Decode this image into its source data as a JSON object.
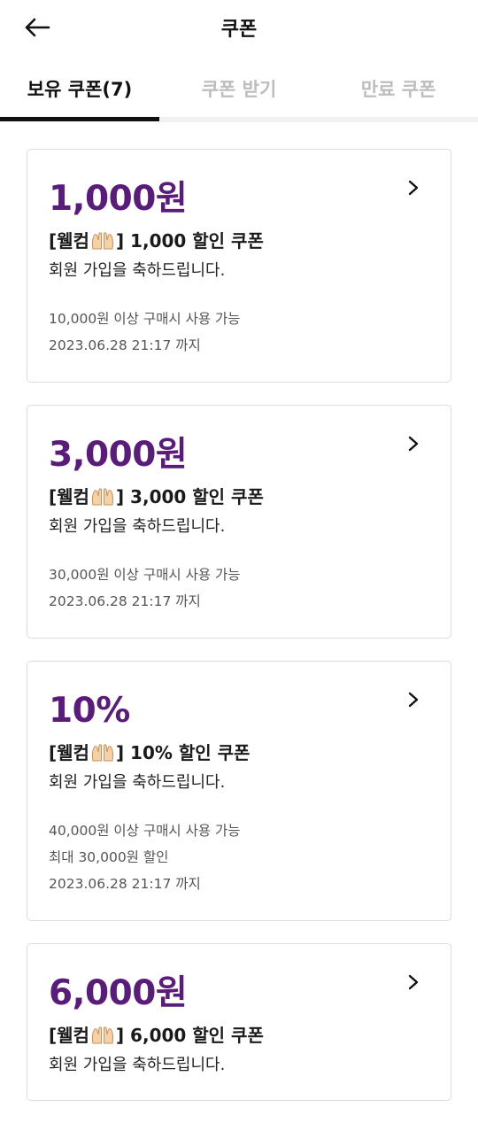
{
  "header": {
    "title": "쿠폰"
  },
  "tabs": [
    {
      "label": "보유 쿠폰(7)",
      "active": true
    },
    {
      "label": "쿠폰 받기",
      "active": false
    },
    {
      "label": "만료 쿠폰",
      "active": false
    }
  ],
  "colors": {
    "accent": "#5a1c7a",
    "active_tab": "#111111",
    "inactive_tab": "#bdbdbd"
  },
  "coupons": [
    {
      "amount": "1,000원",
      "name_prefix": "[웰컴",
      "name_suffix": "] 1,000 할인 쿠폰",
      "icon": "raising-hands-emoji",
      "description": "회원 가입을 축하드립니다.",
      "conditions": [
        "10,000원 이상 구매시 사용 가능",
        "2023.06.28 21:17 까지"
      ]
    },
    {
      "amount": "3,000원",
      "name_prefix": "[웰컴",
      "name_suffix": "] 3,000 할인 쿠폰",
      "icon": "raising-hands-emoji",
      "description": "회원 가입을 축하드립니다.",
      "conditions": [
        "30,000원 이상 구매시 사용 가능",
        "2023.06.28 21:17 까지"
      ]
    },
    {
      "amount": "10%",
      "name_prefix": "[웰컴",
      "name_suffix": "] 10% 할인 쿠폰",
      "icon": "raising-hands-emoji",
      "description": "회원 가입을 축하드립니다.",
      "conditions": [
        "40,000원 이상 구매시 사용 가능",
        "최대 30,000원 할인",
        "2023.06.28 21:17 까지"
      ]
    },
    {
      "amount": "6,000원",
      "name_prefix": "[웰컴",
      "name_suffix": "] 6,000 할인 쿠폰",
      "icon": "raising-hands-emoji",
      "description": "회원 가입을 축하드립니다.",
      "conditions": []
    }
  ]
}
